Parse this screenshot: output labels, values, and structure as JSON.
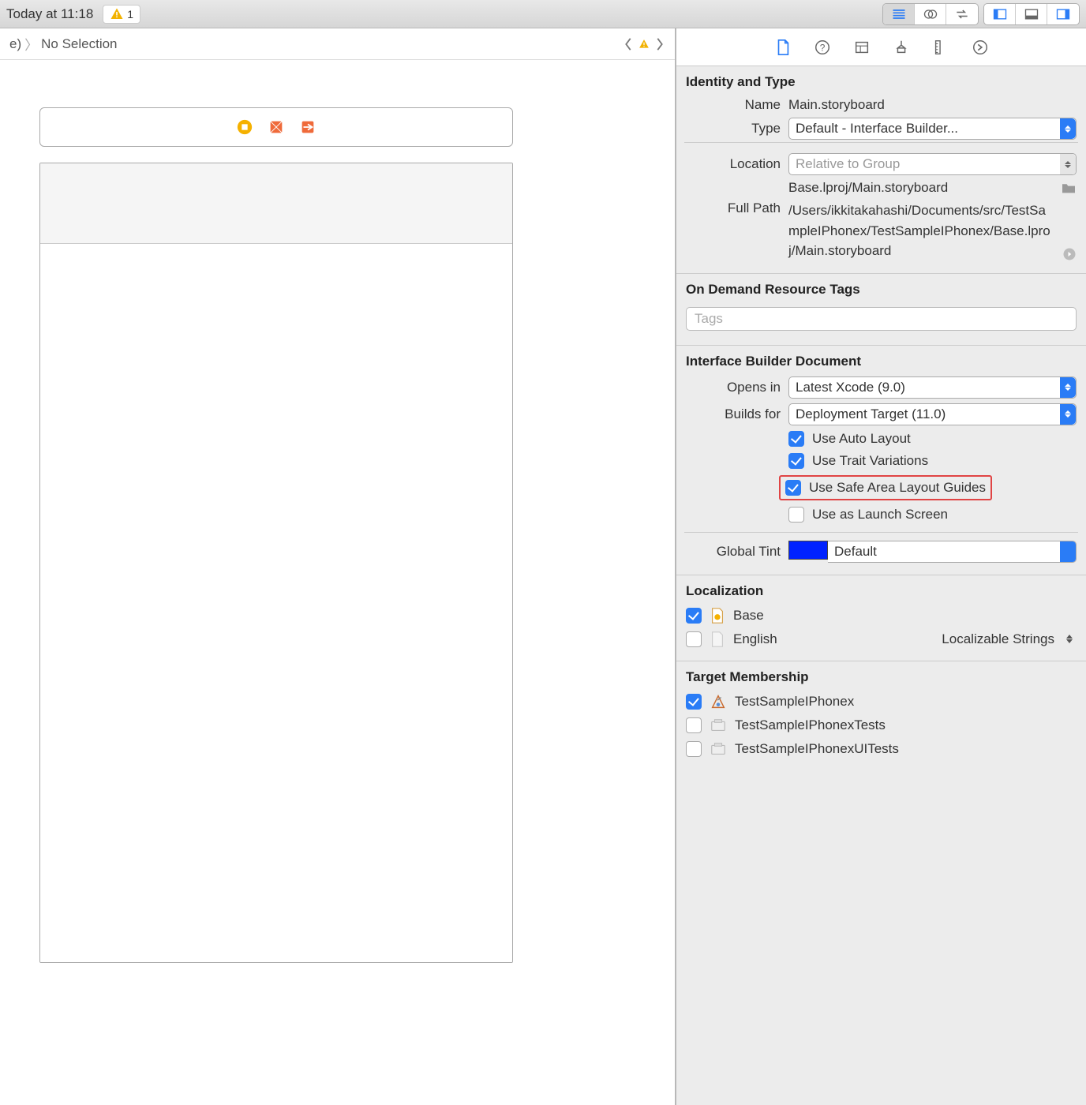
{
  "topbar": {
    "timestamp": "Today at 11:18",
    "warning_count": "1"
  },
  "breadcrumb": {
    "prefix": "e)",
    "selection": "No Selection"
  },
  "inspector": {
    "identity": {
      "title": "Identity and Type",
      "name_label": "Name",
      "name_value": "Main.storyboard",
      "type_label": "Type",
      "type_value": "Default - Interface Builder...",
      "location_label": "Location",
      "location_value": "Relative to Group",
      "location_path": "Base.lproj/Main.storyboard",
      "fullpath_label": "Full Path",
      "fullpath_value": "/Users/ikkitakahashi/Documents/src/TestSampleIPhonex/TestSampleIPhonex/Base.lproj/Main.storyboard"
    },
    "odr": {
      "title": "On Demand Resource Tags",
      "placeholder": "Tags"
    },
    "ibdoc": {
      "title": "Interface Builder Document",
      "opensin_label": "Opens in",
      "opensin_value": "Latest Xcode (9.0)",
      "builds_label": "Builds for",
      "builds_value": "Deployment Target (11.0)",
      "chk_autolayout": "Use Auto Layout",
      "chk_trait": "Use Trait Variations",
      "chk_safearea": "Use Safe Area Layout Guides",
      "chk_launch": "Use as Launch Screen",
      "tint_label": "Global Tint",
      "tint_value": "Default"
    },
    "localization": {
      "title": "Localization",
      "base": "Base",
      "english": "English",
      "english_type": "Localizable Strings"
    },
    "target": {
      "title": "Target Membership",
      "t1": "TestSampleIPhonex",
      "t2": "TestSampleIPhonexTests",
      "t3": "TestSampleIPhonexUITests"
    }
  }
}
